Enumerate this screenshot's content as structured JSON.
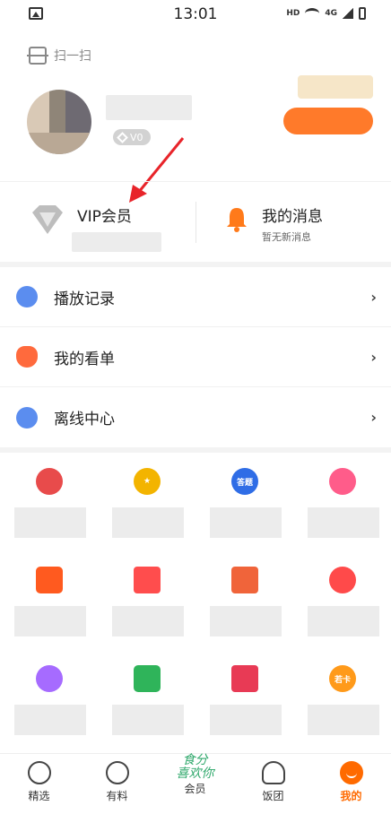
{
  "status_bar": {
    "time": "13:01",
    "network": "HD",
    "signal_label": "4G"
  },
  "scan": {
    "icon": "scan-icon",
    "label": "扫一扫"
  },
  "profile": {
    "level_badge": "V0"
  },
  "vip": {
    "title": "VIP会员",
    "icon": "diamond-icon"
  },
  "messages": {
    "title": "我的消息",
    "subtitle": "暂无新消息",
    "icon": "bell-icon"
  },
  "list": {
    "items": [
      {
        "label": "播放记录",
        "icon": "clock-icon",
        "color": "#5b8def"
      },
      {
        "label": "我的看单",
        "icon": "heart-plus-icon",
        "color": "#ff6a3d"
      },
      {
        "label": "离线中心",
        "icon": "download-icon",
        "color": "#5b8def"
      }
    ],
    "chevron": "›"
  },
  "grid": {
    "items": [
      {
        "icon": "mouth-icon",
        "color": "#e84b4b",
        "text": ""
      },
      {
        "icon": "star-icon",
        "color": "#f3b400",
        "text": "★"
      },
      {
        "icon": "quiz-icon",
        "color": "#2f6de6",
        "text": "答题"
      },
      {
        "icon": "robot-icon",
        "color": "#ff5c8a",
        "text": ""
      },
      {
        "icon": "wallet-icon",
        "color": "#ff5a1f",
        "text": ""
      },
      {
        "icon": "ticket-icon",
        "color": "#ff4d4d",
        "text": ""
      },
      {
        "icon": "book-icon",
        "color": "#f0643a",
        "text": ""
      },
      {
        "icon": "speaker-icon",
        "color": "#ff4a4a",
        "text": ""
      },
      {
        "icon": "bear-icon",
        "color": "#a66bff",
        "text": ""
      },
      {
        "icon": "phone-drive-icon",
        "color": "#2fb45a",
        "text": ""
      },
      {
        "icon": "cart-icon",
        "color": "#e83a55",
        "text": ""
      },
      {
        "icon": "card-icon",
        "color": "#ff9a1a",
        "text": "若卡"
      }
    ]
  },
  "nav": {
    "items": [
      {
        "label": "精选",
        "icon": "m-logo-icon"
      },
      {
        "label": "有料",
        "icon": "spiral-icon"
      },
      {
        "label": "会员",
        "icon": "food-art-icon",
        "art": "食分\n喜欢你"
      },
      {
        "label": "饭团",
        "icon": "riceball-icon"
      },
      {
        "label": "我的",
        "icon": "smile-icon",
        "active": true
      }
    ]
  },
  "colors": {
    "accent": "#ff6a00",
    "bell": "#ff7a1a",
    "vip": "#bfbfbf"
  }
}
